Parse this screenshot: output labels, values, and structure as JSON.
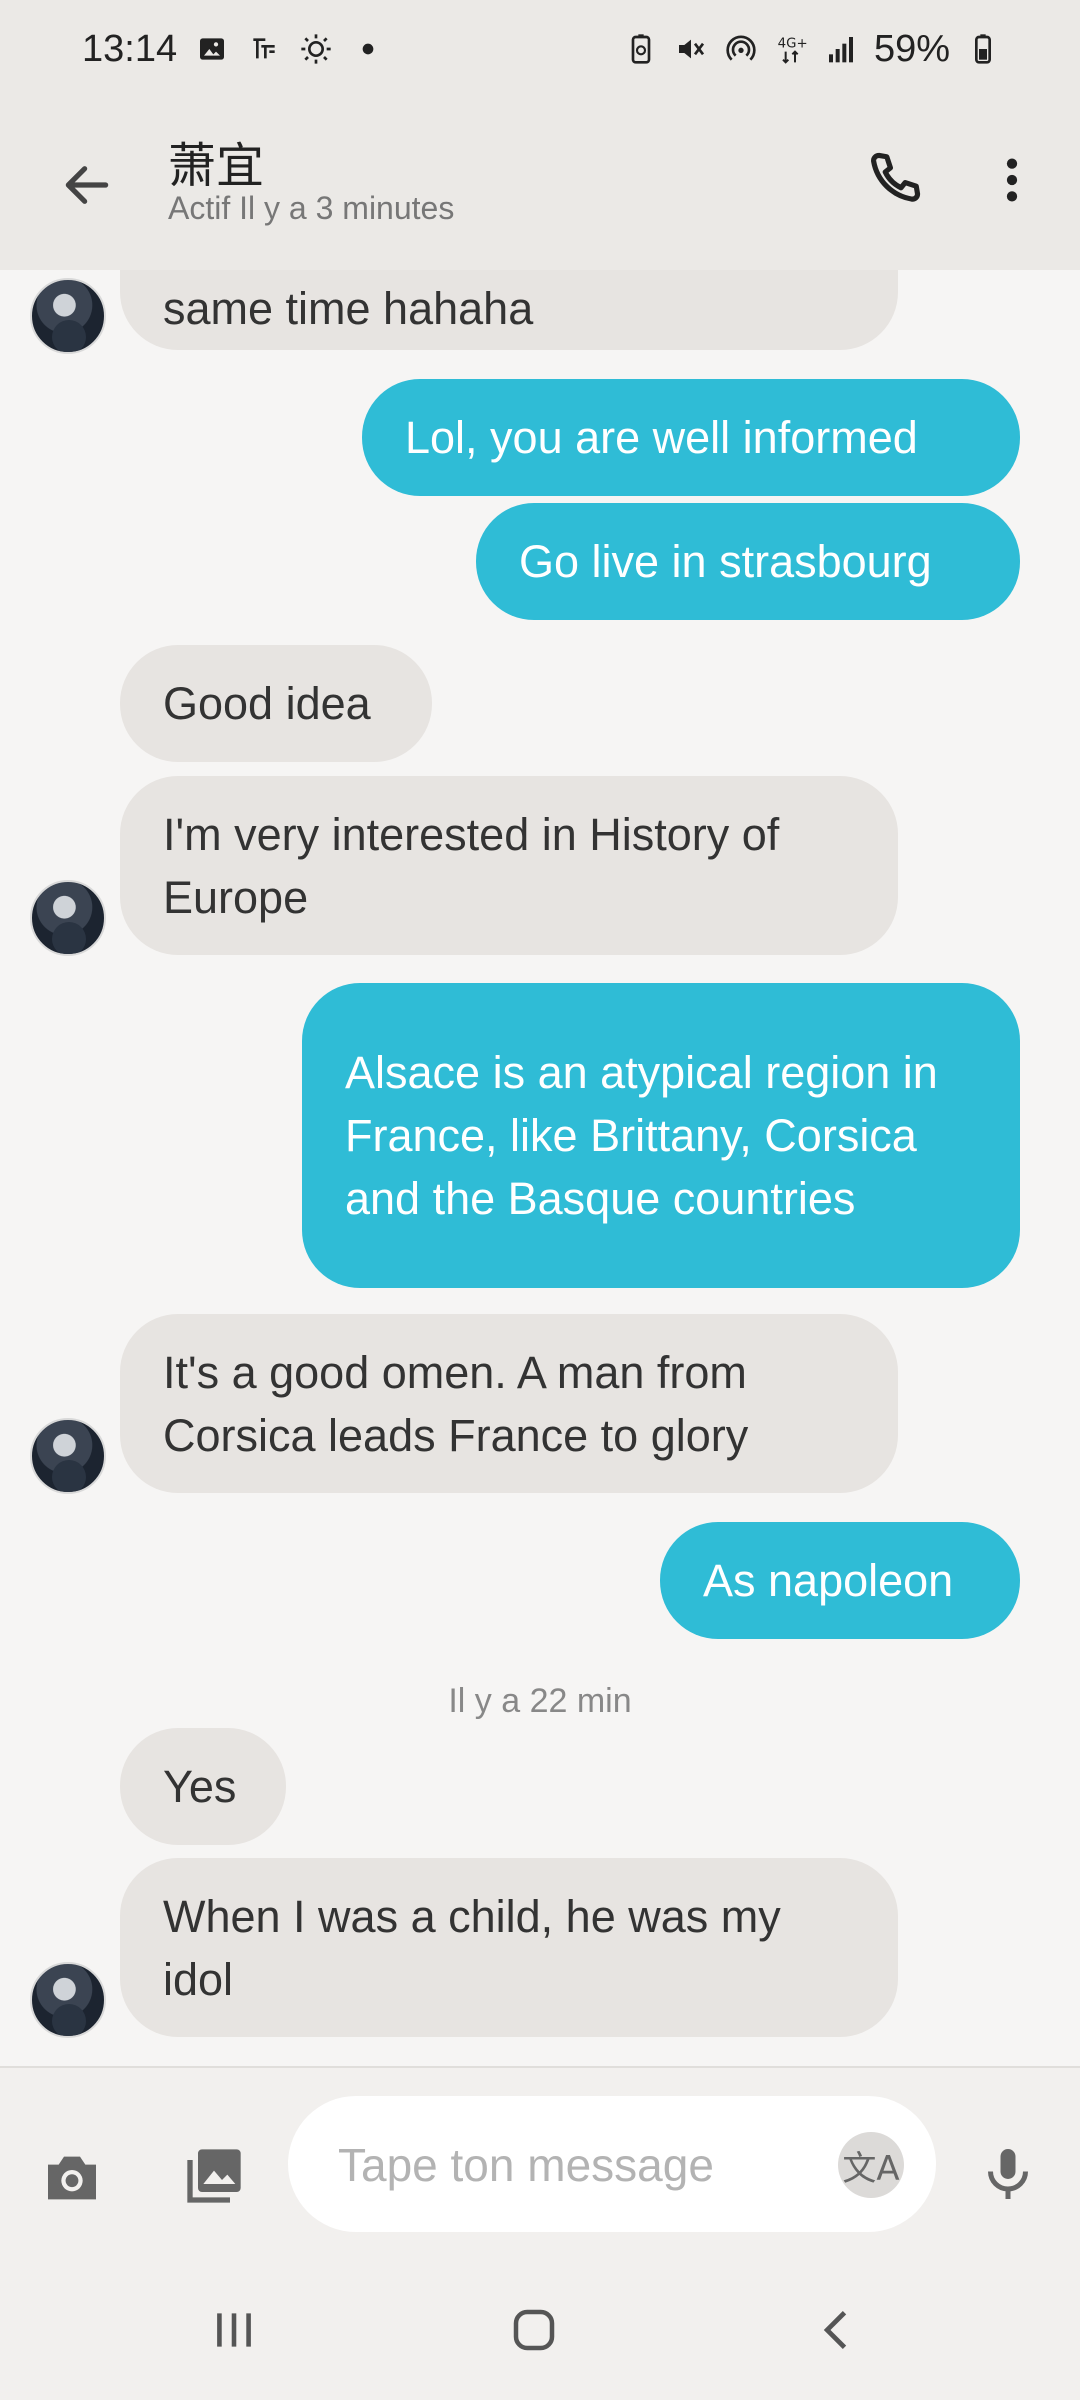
{
  "status_bar": {
    "time": "13:14",
    "battery": "59%",
    "icons": [
      "image-icon",
      "notification-icon",
      "brightness-icon",
      "dot-icon",
      "battery-saver-icon",
      "mute-icon",
      "hotspot-icon",
      "4g-icon",
      "signal-icon",
      "battery-icon"
    ]
  },
  "header": {
    "name": "萧宜",
    "status": "Actif Il y a 3 minutes"
  },
  "messages": [
    {
      "dir": "in",
      "text": "same time hahaha"
    },
    {
      "dir": "out",
      "text": "Lol, you are well informed"
    },
    {
      "dir": "out",
      "text": "Go live in strasbourg"
    },
    {
      "dir": "in",
      "text": "Good idea"
    },
    {
      "dir": "in",
      "text": "I'm very interested in History of Europe"
    },
    {
      "dir": "out",
      "text": "Alsace is an atypical region in France, like Brittany, Corsica and the Basque countries"
    },
    {
      "dir": "in",
      "text": "It's a good omen. A man from Corsica leads France to glory"
    },
    {
      "dir": "out",
      "text": "As napoleon"
    },
    {
      "dir": "in",
      "text": "Yes"
    },
    {
      "dir": "in",
      "text": "When I was a child, he was my idol"
    }
  ],
  "timestamp": "Il y a 22 min",
  "composer": {
    "placeholder": "Tape ton message",
    "value": "",
    "translate_glyph": "文A"
  },
  "colors": {
    "outgoing": "#2fbcd6",
    "incoming": "#e7e4e1",
    "header_bg": "#ebe9e6"
  }
}
